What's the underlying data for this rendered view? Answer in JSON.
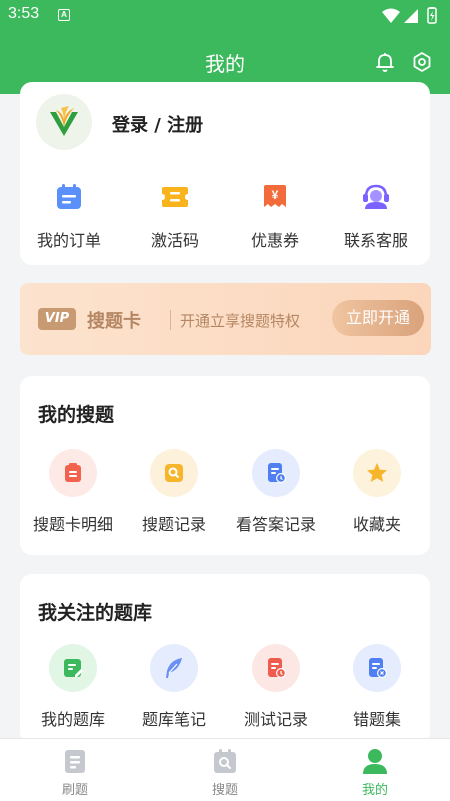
{
  "status_bar": {
    "time": "3:53",
    "notif": "A"
  },
  "header": {
    "title": "我的"
  },
  "user": {
    "login_text": "登录 / 注册"
  },
  "quick_actions": [
    {
      "label": "我的订单",
      "icon": "calendar-icon"
    },
    {
      "label": "激活码",
      "icon": "ticket-icon"
    },
    {
      "label": "优惠券",
      "icon": "coupon-icon"
    },
    {
      "label": "联系客服",
      "icon": "headset-icon"
    }
  ],
  "vip": {
    "badge": "VIP",
    "title": "搜题卡",
    "desc": "开通立享搜题特权",
    "button": "立即开通"
  },
  "section_search": {
    "title": "我的搜题",
    "items": [
      {
        "label": "搜题卡明细",
        "icon": "card-detail-icon"
      },
      {
        "label": "搜题记录",
        "icon": "search-record-icon"
      },
      {
        "label": "看答案记录",
        "icon": "answer-record-icon"
      },
      {
        "label": "收藏夹",
        "icon": "star-icon"
      }
    ]
  },
  "section_banks": {
    "title": "我关注的题库",
    "items": [
      {
        "label": "我的题库",
        "icon": "edit-note-icon"
      },
      {
        "label": "题库笔记",
        "icon": "feather-icon"
      },
      {
        "label": "测试记录",
        "icon": "test-record-icon"
      },
      {
        "label": "错题集",
        "icon": "wrong-set-icon"
      }
    ]
  },
  "bottom_nav": [
    {
      "label": "刷题",
      "active": false
    },
    {
      "label": "搜题",
      "active": false
    },
    {
      "label": "我的",
      "active": true
    }
  ],
  "colors": {
    "primary": "#3cb95c",
    "vip_text": "#b58663"
  }
}
